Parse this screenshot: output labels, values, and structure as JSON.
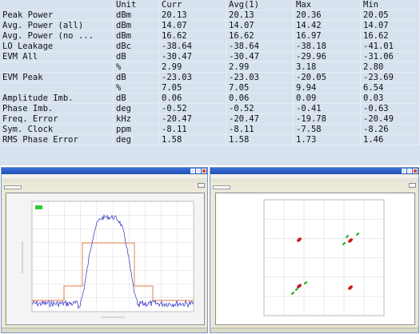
{
  "table": {
    "headers": [
      "",
      "Unit",
      "Curr",
      "Avg(1)",
      "Max",
      "Min"
    ],
    "rows": [
      [
        "Peak Power",
        "dBm",
        "20.13",
        "20.13",
        "20.36",
        "20.05"
      ],
      [
        "Avg. Power (all)",
        "dBm",
        "14.07",
        "14.07",
        "14.42",
        "14.07"
      ],
      [
        "Avg. Power (no ...",
        "dBm",
        "16.62",
        "16.62",
        "16.97",
        "16.62"
      ],
      [
        "LO Leakage",
        "dBc",
        "-38.64",
        "-38.64",
        "-38.18",
        "-41.01"
      ],
      [
        "EVM All",
        "dB",
        "-30.47",
        "-30.47",
        "-29.96",
        "-31.06"
      ],
      [
        "",
        "%",
        "2.99",
        "2.99",
        "3.18",
        "2.80"
      ],
      [
        "EVM Peak",
        "dB",
        "-23.03",
        "-23.03",
        "-20.05",
        "-23.69"
      ],
      [
        "",
        "%",
        "7.05",
        "7.05",
        "9.94",
        "6.54"
      ],
      [
        "Amplitude Imb.",
        "dB",
        "0.06",
        "0.06",
        "0.09",
        "0.03"
      ],
      [
        "Phase Imb.",
        "deg",
        "-0.52",
        "-0.52",
        "-0.41",
        "-0.63"
      ],
      [
        "Freq. Error",
        "kHz",
        "-20.47",
        "-20.47",
        "-19.78",
        "-20.49"
      ],
      [
        "Sym. Clock",
        "ppm",
        "-8.11",
        "-8.11",
        "-7.58",
        "-8.26"
      ],
      [
        "RMS Phase Error",
        "deg",
        "1.58",
        "1.58",
        "1.73",
        "1.46"
      ]
    ]
  },
  "windows": {
    "left": {
      "title": "",
      "menu": "",
      "toolbar": "",
      "control_label": ""
    },
    "right": {
      "title": "",
      "menu": "",
      "toolbar": "",
      "control_label": ""
    }
  },
  "colors": {
    "table_bg": "#d7e2ef",
    "trace": "#2b2bc8",
    "mask": "#e07a3f",
    "constellation_red": "#cc1a1a",
    "constellation_green": "#27b327",
    "title_bar": "#2a5dc4"
  },
  "icons": [
    "app-icon",
    "minimize-icon",
    "maximize-icon",
    "close-icon"
  ]
}
